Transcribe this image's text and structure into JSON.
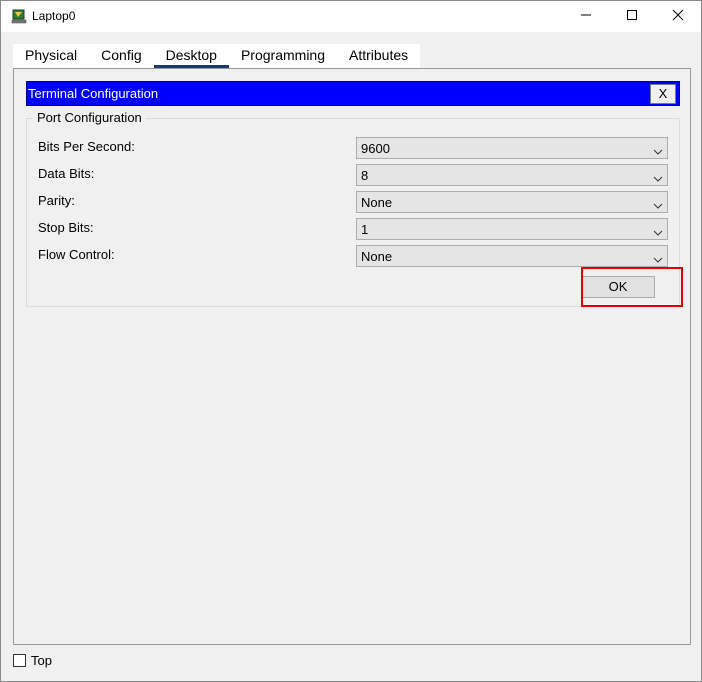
{
  "window": {
    "title": "Laptop0",
    "icon": "laptop-app-icon",
    "controls": [
      "minimize-icon",
      "maximize-icon",
      "close-icon"
    ]
  },
  "tabs": [
    {
      "label": "Physical",
      "active": false
    },
    {
      "label": "Config",
      "active": false
    },
    {
      "label": "Desktop",
      "active": true
    },
    {
      "label": "Programming",
      "active": false
    },
    {
      "label": "Attributes",
      "active": false
    }
  ],
  "terminal": {
    "title": "Terminal Configuration",
    "close_label": "X",
    "header_color": "#0000ff"
  },
  "port_config": {
    "legend": "Port Configuration",
    "fields": [
      {
        "label": "Bits Per Second:",
        "value": "9600"
      },
      {
        "label": "Data Bits:",
        "value": "8"
      },
      {
        "label": "Parity:",
        "value": "None"
      },
      {
        "label": "Stop Bits:",
        "value": "1"
      },
      {
        "label": "Flow Control:",
        "value": "None"
      }
    ],
    "ok_label": "OK",
    "highlight_color": "#e00000"
  },
  "footer": {
    "top_label": "Top",
    "top_checked": false
  }
}
